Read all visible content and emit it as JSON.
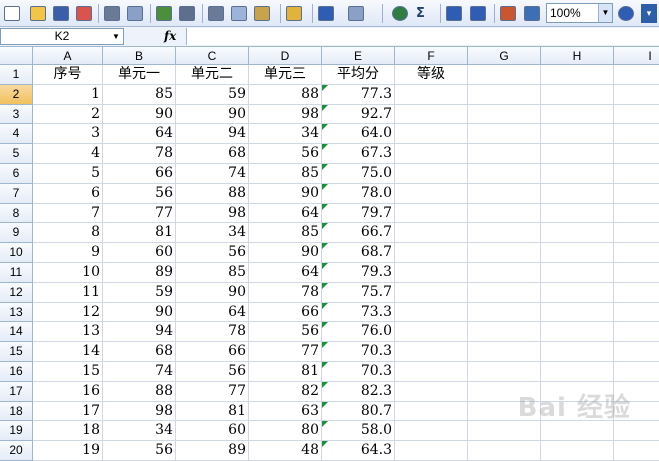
{
  "toolbar": {
    "icons": [
      "new-icon",
      "open-icon",
      "save-icon",
      "permission-icon",
      "print-icon",
      "print-preview-icon",
      "spelling-icon",
      "research-icon",
      "cut-icon",
      "copy-icon",
      "paste-icon",
      "format-painter-icon",
      "undo-icon",
      "redo-icon",
      "hyperlink-icon",
      "autosum-icon",
      "sort-ascending-icon",
      "sort-descending-icon",
      "chart-wizard-icon",
      "drawing-icon",
      "help-icon"
    ],
    "autosum_glyph": "Σ",
    "zoom_value": "100%"
  },
  "formula_bar": {
    "name_box": "K2",
    "fx_label": "fx",
    "content": ""
  },
  "columns": [
    "A",
    "B",
    "C",
    "D",
    "E",
    "F",
    "G",
    "H",
    "I"
  ],
  "rows": [
    "1",
    "2",
    "3",
    "4",
    "5",
    "6",
    "7",
    "8",
    "9",
    "10",
    "11",
    "12",
    "13",
    "14",
    "15",
    "16",
    "17",
    "18",
    "19",
    "20"
  ],
  "table": {
    "headers": [
      "序号",
      "单元一",
      "单元二",
      "单元三",
      "平均分",
      "等级"
    ],
    "data": [
      [
        "1",
        "85",
        "59",
        "88",
        "77.3"
      ],
      [
        "2",
        "90",
        "90",
        "98",
        "92.7"
      ],
      [
        "3",
        "64",
        "94",
        "34",
        "64.0"
      ],
      [
        "4",
        "78",
        "68",
        "56",
        "67.3"
      ],
      [
        "5",
        "66",
        "74",
        "85",
        "75.0"
      ],
      [
        "6",
        "56",
        "88",
        "90",
        "78.0"
      ],
      [
        "7",
        "77",
        "98",
        "64",
        "79.7"
      ],
      [
        "8",
        "81",
        "34",
        "85",
        "66.7"
      ],
      [
        "9",
        "60",
        "56",
        "90",
        "68.7"
      ],
      [
        "10",
        "89",
        "85",
        "64",
        "79.3"
      ],
      [
        "11",
        "59",
        "90",
        "78",
        "75.7"
      ],
      [
        "12",
        "90",
        "64",
        "66",
        "73.3"
      ],
      [
        "13",
        "94",
        "78",
        "56",
        "76.0"
      ],
      [
        "14",
        "68",
        "66",
        "77",
        "70.3"
      ],
      [
        "15",
        "74",
        "56",
        "81",
        "70.3"
      ],
      [
        "16",
        "88",
        "77",
        "82",
        "82.3"
      ],
      [
        "17",
        "98",
        "81",
        "63",
        "80.7"
      ],
      [
        "18",
        "34",
        "60",
        "80",
        "58.0"
      ],
      [
        "19",
        "56",
        "89",
        "48",
        "64.3"
      ]
    ]
  },
  "selected_cell": "K2",
  "active_row": "2",
  "watermark": "Bai 经验",
  "colors": {
    "grid_line": "#d0d7e5",
    "header_border": "#9eb6ce",
    "error_marker": "#1b8f3a"
  }
}
